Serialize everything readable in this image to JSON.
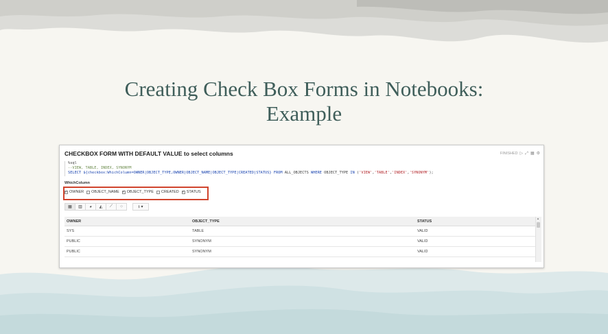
{
  "slide": {
    "title_line1": "Creating Check Box Forms in Notebooks:",
    "title_line2": "Example"
  },
  "paragraph": {
    "title": "CHECKBOX FORM WITH DEFAULT VALUE to select columns",
    "status": "FINISHED",
    "code": {
      "line1": "%sql",
      "line2": "--VIEW, TABLE, INDEX, SYNONYM",
      "line3_pre": "SELECT ${checkbox:WhichColumn=OWNER|OBJECT_TYPE,OWNER|OBJECT_NAME|OBJECT_TYPE|CREATED|STATUS} ",
      "line3_from": "FROM",
      "line3_mid": " ALL_OBJECTS ",
      "line3_where": "WHERE",
      "line3_col": " OBJECT_TYPE ",
      "line3_in": "IN",
      "line3_open": " (",
      "line3_v1": "'VIEW'",
      "line3_v2": "'TABLE'",
      "line3_v3": "'INDEX'",
      "line3_v4": "'SYNONYM'",
      "line3_close": ");"
    },
    "form": {
      "label": "WhichColumn",
      "checkboxes": [
        {
          "label": "OWNER",
          "checked": true
        },
        {
          "label": "OBJECT_NAME",
          "checked": false
        },
        {
          "label": "OBJECT_TYPE",
          "checked": true
        },
        {
          "label": "CREATED",
          "checked": false
        },
        {
          "label": "STATUS",
          "checked": true
        }
      ]
    },
    "result": {
      "columns": [
        "OWNER",
        "OBJECT_TYPE",
        "STATUS"
      ],
      "rows": [
        [
          "SYS",
          "TABLE",
          "VALID"
        ],
        [
          "PUBLIC",
          "SYNONYM",
          "VALID"
        ],
        [
          "PUBLIC",
          "SYNONYM",
          "VALID"
        ]
      ]
    }
  },
  "colors": {
    "title": "#3f5e5a",
    "highlight_border": "#d0432c",
    "background": "#f7f6f1"
  }
}
